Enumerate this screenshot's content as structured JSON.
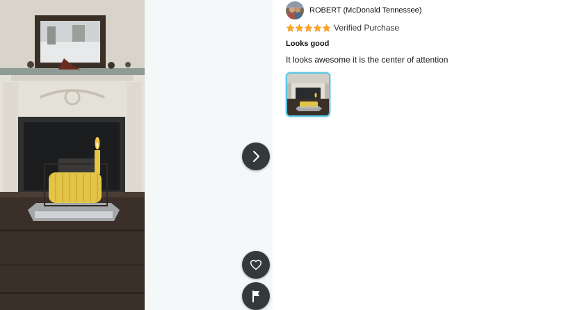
{
  "gallery": {
    "main_photo_alt": "Customer image",
    "next_icon": "chevron-right-icon",
    "like_icon": "heart-icon",
    "report_icon": "flag-icon"
  },
  "review": {
    "reviewer_name": "ROBERT (McDonald Tennessee)",
    "rating": 5,
    "rating_max": 5,
    "verified_label": "Verified Purchase",
    "title": "Looks good",
    "body": "It looks awesome it is the center of attention",
    "star_color": "#FFA41C",
    "thumbnail_border_color": "#5AC8E6"
  }
}
